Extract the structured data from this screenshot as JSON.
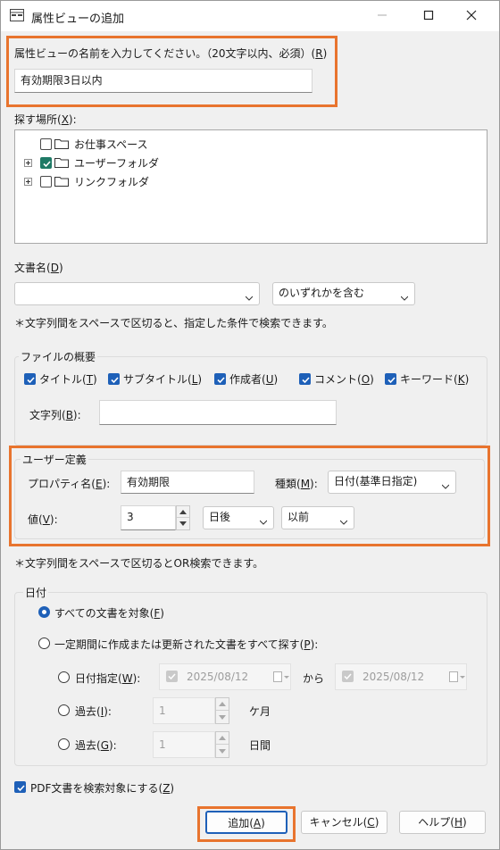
{
  "window": {
    "title": "属性ビューの追加"
  },
  "view_name": {
    "label": "属性ビューの名前を入力してください。（20文字以内、必須）(",
    "key": "R",
    "suffix": ")",
    "value": "有効期限3日以内"
  },
  "search_location": {
    "label": "探す場所(",
    "key": "X",
    "suffix": "):",
    "tree": [
      {
        "label": "お仕事スペース",
        "checked": false,
        "expandable": false
      },
      {
        "label": "ユーザーフォルダ",
        "checked": true,
        "expandable": true
      },
      {
        "label": "リンクフォルダ",
        "checked": false,
        "expandable": true
      }
    ]
  },
  "doc_name": {
    "label": "文書名(",
    "key": "D",
    "suffix": ")",
    "value": "",
    "match_mode": "のいずれかを含む",
    "note": "＊文字列間をスペースで区切ると、指定した条件で検索できます。"
  },
  "file_summary": {
    "title": "ファイルの概要",
    "checkboxes": [
      {
        "label": "タイトル(",
        "key": "T",
        "suffix": ")",
        "checked": true
      },
      {
        "label": "サブタイトル(",
        "key": "L",
        "suffix": ")",
        "checked": true
      },
      {
        "label": "作成者(",
        "key": "U",
        "suffix": ")",
        "checked": true
      },
      {
        "label": "コメント(",
        "key": "O",
        "suffix": ")",
        "checked": true
      },
      {
        "label": "キーワード(",
        "key": "K",
        "suffix": ")",
        "checked": true
      }
    ],
    "string_label": "文字列(",
    "string_key": "B",
    "string_suffix": "):",
    "string_value": ""
  },
  "user_defined": {
    "title": "ユーザー定義",
    "property_label": "プロパティ名(",
    "property_key": "E",
    "property_suffix": "):",
    "property_value": "有効期限",
    "type_label": "種類(",
    "type_key": "M",
    "type_suffix": "):",
    "type_value": "日付(基準日指定)",
    "value_label": "値(",
    "value_key": "V",
    "value_suffix": "):",
    "value_number": "3",
    "unit_value": "日後",
    "relation_value": "以前",
    "note": "＊文字列間をスペースで区切るとOR検索できます。"
  },
  "date": {
    "title": "日付",
    "all_docs": {
      "label": "すべての文書を対象(",
      "key": "F",
      "suffix": ")",
      "selected": true
    },
    "period": {
      "label": "一定期間に作成または更新された文書をすべて探す(",
      "key": "P",
      "suffix": "):",
      "selected": false
    },
    "specify": {
      "label": "日付指定(",
      "key": "W",
      "suffix": "):",
      "from": "2025/08/12",
      "between": "から",
      "to": "2025/08/12"
    },
    "past_months": {
      "label": "過去(",
      "key": "I",
      "suffix": "):",
      "value": "1",
      "unit": "ケ月"
    },
    "past_days": {
      "label": "過去(",
      "key": "G",
      "suffix": "):",
      "value": "1",
      "unit": "日間"
    }
  },
  "pdf": {
    "label": "PDF文書を検索対象にする(",
    "key": "Z",
    "suffix": ")",
    "checked": true
  },
  "buttons": {
    "add": {
      "label": "追加(",
      "key": "A",
      "suffix": ")"
    },
    "cancel": {
      "label": "キャンセル(",
      "key": "C",
      "suffix": ")"
    },
    "help": {
      "label": "ヘルプ(",
      "key": "H",
      "suffix": ")"
    }
  },
  "colors": {
    "accent": "#1e60b8",
    "highlight": "#e8742e",
    "checked_tree": "#1f7a66"
  }
}
